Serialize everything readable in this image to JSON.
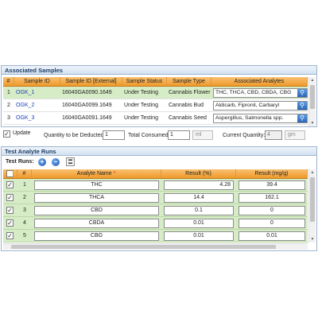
{
  "samples_panel": {
    "title": "Associated Samples",
    "columns": [
      "#",
      "Sample ID",
      "Sample ID [External]",
      "Sample Status",
      "Sample Type",
      "Associated Analytes"
    ],
    "rows": [
      {
        "num": "1",
        "sample_id": "OGK_1",
        "external_id": "16040GA0090.1649",
        "status": "Under Testing",
        "type": "Cannabis Flower",
        "analytes": "THC, THCA, CBD, CBDA, CBG"
      },
      {
        "num": "2",
        "sample_id": "OGK_2",
        "external_id": "16040GA0099.1649",
        "status": "Under Testing",
        "type": "Cannabis Bud",
        "analytes": "Aldicarb, Fipronil, Carbaryl"
      },
      {
        "num": "3",
        "sample_id": "OGK_3",
        "external_id": "16040GA0091.1649",
        "status": "Under Testing",
        "type": "Cannabis Seed",
        "analytes": "Aspergillus, Salmonella spp."
      }
    ],
    "selected_row": 1
  },
  "update_bar": {
    "update_label": "Update",
    "update_checked": true,
    "qty_label": "Quantity to be Deducted",
    "qty_value": "1",
    "total_label": "Total Consumed",
    "total_value": "1",
    "total_unit": "ml",
    "current_label": "Current Quantity:",
    "current_value": "4",
    "current_unit": "gm"
  },
  "runs_panel": {
    "title": "Test Analyte Runs",
    "toolbar_label": "Test Runs:",
    "add_icon": "plus-circle-icon",
    "remove_icon": "minus-circle-icon",
    "columns": {
      "num": "#",
      "name": "Analyte Name",
      "required_mark": "*",
      "pct": "Result (%)",
      "mg": "Result (mg/g)"
    },
    "rows": [
      {
        "num": "1",
        "name": "THC",
        "pct": "4.28",
        "mg": "39.4",
        "checked": true
      },
      {
        "num": "2",
        "name": "THCA",
        "pct": "14.4",
        "mg": "162.1",
        "checked": true
      },
      {
        "num": "3",
        "name": "CBD",
        "pct": "0.1",
        "mg": "0",
        "checked": true
      },
      {
        "num": "4",
        "name": "CBDA",
        "pct": "0.01",
        "mg": "0",
        "checked": true
      },
      {
        "num": "5",
        "name": "CBG",
        "pct": "0.01",
        "mg": "0.01",
        "checked": true
      }
    ]
  },
  "colors": {
    "header_orange": "#ef9a2a",
    "row_green": "#d6ecc6",
    "link_blue": "#1a3fb8",
    "panel_title": "#1e3f66"
  }
}
